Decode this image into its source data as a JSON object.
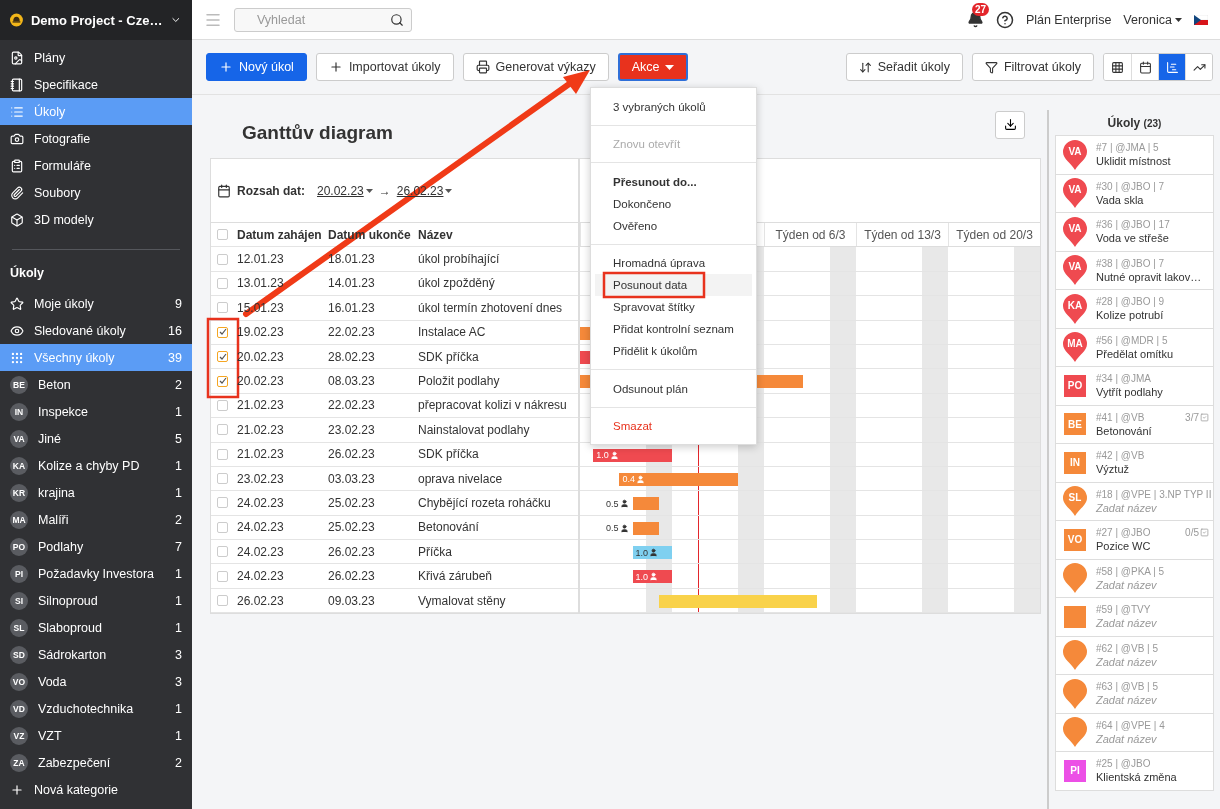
{
  "project": {
    "name": "Demo Project - Cze…"
  },
  "nav": [
    {
      "kind": "plans",
      "label": "Plány",
      "selected": false
    },
    {
      "kind": "specs",
      "label": "Specifikace",
      "selected": false
    },
    {
      "kind": "tasks",
      "label": "Úkoly",
      "selected": true
    },
    {
      "kind": "photos",
      "label": "Fotografie",
      "selected": false
    },
    {
      "kind": "forms",
      "label": "Formuláře",
      "selected": false
    },
    {
      "kind": "files",
      "label": "Soubory",
      "selected": false
    },
    {
      "kind": "models",
      "label": "3D modely",
      "selected": false
    }
  ],
  "section_title": "Úkoly",
  "filters": [
    {
      "kind": "star",
      "label": "Moje úkoly",
      "count": "9",
      "selected": false
    },
    {
      "kind": "eye",
      "label": "Sledované úkoly",
      "count": "16",
      "selected": false
    },
    {
      "kind": "grid",
      "label": "Všechny úkoly",
      "count": "39",
      "selected": true
    }
  ],
  "categories": [
    {
      "abbr": "BE",
      "label": "Beton",
      "count": "2"
    },
    {
      "abbr": "IN",
      "label": "Inspekce",
      "count": "1"
    },
    {
      "abbr": "VA",
      "label": "Jiné",
      "count": "5"
    },
    {
      "abbr": "KA",
      "label": "Kolize a chyby PD",
      "count": "1"
    },
    {
      "abbr": "KR",
      "label": "krajina",
      "count": "1"
    },
    {
      "abbr": "MA",
      "label": "Malíři",
      "count": "2"
    },
    {
      "abbr": "PO",
      "label": "Podlahy",
      "count": "7"
    },
    {
      "abbr": "PI",
      "label": "Požadavky Investora",
      "count": "1"
    },
    {
      "abbr": "SI",
      "label": "Silnoproud",
      "count": "1"
    },
    {
      "abbr": "SL",
      "label": "Slaboproud",
      "count": "1"
    },
    {
      "abbr": "SD",
      "label": "Sádrokarton",
      "count": "3"
    },
    {
      "abbr": "VO",
      "label": "Voda",
      "count": "3"
    },
    {
      "abbr": "VD",
      "label": "Vzduchotechnika",
      "count": "1"
    },
    {
      "abbr": "VZ",
      "label": "VZT",
      "count": "1"
    },
    {
      "abbr": "ZA",
      "label": "Zabezpečení",
      "count": "2"
    }
  ],
  "add_category": "Nová kategorie",
  "topbar": {
    "search_placeholder": "Vyhledat",
    "notifications": "27",
    "plan": "Plán Enterprise",
    "user": "Veronica"
  },
  "toolbar": {
    "left": [
      {
        "kind": "create",
        "label": "Nový úkol"
      },
      {
        "kind": "import",
        "label": "Importovat úkoly"
      },
      {
        "kind": "report",
        "label": "Generovat výkazy"
      },
      {
        "kind": "actions",
        "label": "Akce"
      }
    ],
    "right": [
      {
        "kind": "sort",
        "label": "Seřadit úkoly"
      },
      {
        "kind": "filter",
        "label": "Filtrovat úkoly"
      }
    ],
    "views": [
      {
        "kind": "grid",
        "selected": false
      },
      {
        "kind": "calendar",
        "selected": false
      },
      {
        "kind": "gantt",
        "selected": true
      },
      {
        "kind": "chart",
        "selected": false
      }
    ]
  },
  "menu": {
    "sections": [
      [
        {
          "kind": "normal",
          "label": "3 vybraných úkolů",
          "highlighted": false
        }
      ],
      [
        {
          "kind": "disabled",
          "label": "Znovu otevřít",
          "highlighted": false
        }
      ],
      [
        {
          "kind": "bold",
          "label": "Přesunout do...",
          "highlighted": false
        },
        {
          "kind": "normal",
          "label": "Dokončeno",
          "highlighted": false
        },
        {
          "kind": "normal",
          "label": "Ověřeno",
          "highlighted": false
        }
      ],
      [
        {
          "kind": "normal",
          "label": "Hromadná úprava",
          "highlighted": false
        },
        {
          "kind": "normal",
          "label": "Posunout data",
          "highlighted": true
        },
        {
          "kind": "normal",
          "label": "Spravovat štítky",
          "highlighted": false
        },
        {
          "kind": "normal",
          "label": "Přidat kontrolní seznam",
          "highlighted": false
        },
        {
          "kind": "normal",
          "label": "Přidělit k úkolům",
          "highlighted": false
        }
      ],
      [
        {
          "kind": "normal",
          "label": "Odsunout plán",
          "highlighted": false
        }
      ],
      [
        {
          "kind": "danger",
          "label": "Smazat",
          "highlighted": false
        }
      ]
    ]
  },
  "gantt": {
    "title": "Ganttův diagram",
    "range_label": "Rozsah dat:",
    "range_from": "20.02.23",
    "range_arrow": "→",
    "range_to": "26.02.23",
    "select_all_checked": false,
    "columns": [
      "Datum zahájen",
      "Datum ukonče",
      "Název"
    ],
    "weeks": [
      "Týden od 6/3",
      "Týden od 13/3",
      "Týden od 20/3"
    ],
    "rows": [
      {
        "checked": false,
        "start": "12.01.23",
        "end": "18.01.23",
        "name": "úkol probíhající"
      },
      {
        "checked": false,
        "start": "13.01.23",
        "end": "14.01.23",
        "name": "úkol zpožděný"
      },
      {
        "checked": false,
        "start": "15.01.23",
        "end": "16.01.23",
        "name": "úkol termín zhotovení dnes"
      },
      {
        "checked": true,
        "start": "19.02.23",
        "end": "22.02.23",
        "name": "Instalace AC",
        "bar": {
          "color": "#f5893a"
        }
      },
      {
        "checked": true,
        "start": "20.02.23",
        "end": "28.02.23",
        "name": "SDK příčka",
        "bar": {
          "color": "#ef4a50"
        }
      },
      {
        "checked": true,
        "start": "20.02.23",
        "end": "08.03.23",
        "name": "Položit podlahy",
        "bar": {
          "color": "#f5893a"
        }
      },
      {
        "checked": false,
        "start": "21.02.23",
        "end": "22.02.23",
        "name": "přepracovat kolizi v nákresu"
      },
      {
        "checked": false,
        "start": "21.02.23",
        "end": "23.02.23",
        "name": "Nainstalovat podlahy"
      },
      {
        "checked": false,
        "start": "21.02.23",
        "end": "26.02.23",
        "name": "SDK příčka",
        "bar": {
          "color": "#ef4a50",
          "label": "1.0",
          "outside": false
        }
      },
      {
        "checked": false,
        "start": "23.02.23",
        "end": "03.03.23",
        "name": "oprava nivelace",
        "bar": {
          "color": "#f5893a",
          "label": "0.4",
          "outside": false
        }
      },
      {
        "checked": false,
        "start": "24.02.23",
        "end": "25.02.23",
        "name": "Chybějící rozeta roháčku",
        "bar": {
          "color": "#f5893a",
          "label": "0.5",
          "outside": true
        }
      },
      {
        "checked": false,
        "start": "24.02.23",
        "end": "25.02.23",
        "name": "Betonování",
        "bar": {
          "color": "#f5893a",
          "label": "0.5",
          "outside": true
        }
      },
      {
        "checked": false,
        "start": "24.02.23",
        "end": "26.02.23",
        "name": "Příčka",
        "bar": {
          "color": "#7fd0f0",
          "label": "1.0",
          "outside": false
        }
      },
      {
        "checked": false,
        "start": "24.02.23",
        "end": "26.02.23",
        "name": "Křivá zárubeň",
        "bar": {
          "color": "#ef4a50",
          "label": "1.0",
          "outside": false
        }
      },
      {
        "checked": false,
        "start": "26.02.23",
        "end": "09.03.23",
        "name": "Vymalovat stěny",
        "bar": {
          "color": "#f9d24a"
        }
      }
    ]
  },
  "tasks_panel": {
    "title": "Úkoly",
    "count": "(23)",
    "tasks": [
      {
        "kind": "pin",
        "color": "#ef4a50",
        "abbr": "VA",
        "meta": "#7 | @JMA | 5",
        "name": "Uklidit místnost",
        "untitled": false
      },
      {
        "kind": "pin",
        "color": "#ef4a50",
        "abbr": "VA",
        "meta": "#30 | @JBO | 7",
        "name": "Vada skla",
        "untitled": false
      },
      {
        "kind": "pin",
        "color": "#ef4a50",
        "abbr": "VA",
        "meta": "#36 | @JBO | 17",
        "name": "Voda ve střeše",
        "untitled": false
      },
      {
        "kind": "pin",
        "color": "#ef4a50",
        "abbr": "VA",
        "meta": "#38 | @JBO | 7",
        "name": "Nutné opravit lakov…",
        "untitled": false
      },
      {
        "kind": "pin",
        "color": "#ef4a50",
        "abbr": "KA",
        "meta": "#28 | @JBO | 9",
        "name": "Kolize potrubí",
        "untitled": false
      },
      {
        "kind": "pin",
        "color": "#ef4a50",
        "abbr": "MA",
        "meta": "#56 | @MDR | 5",
        "name": "Předělat omítku",
        "untitled": false
      },
      {
        "kind": "square",
        "color": "#ef4a50",
        "abbr": "PO",
        "meta": "#34 | @JMA",
        "name": "Vytřít podlahy",
        "untitled": false
      },
      {
        "kind": "square",
        "color": "#f5893a",
        "abbr": "BE",
        "meta": "#41 | @VB",
        "name": "Betonování",
        "untitled": false,
        "progress": "3/7"
      },
      {
        "kind": "square",
        "color": "#f5893a",
        "abbr": "IN",
        "meta": "#42 | @VB",
        "name": "Výztuž",
        "untitled": false
      },
      {
        "kind": "pin",
        "color": "#f5893a",
        "abbr": "SL",
        "meta": "#18 | @VPE | 3.NP TYP II",
        "name": "Zadat název",
        "untitled": true
      },
      {
        "kind": "square",
        "color": "#f5893a",
        "abbr": "VO",
        "meta": "#27 | @JBO",
        "name": "Pozice WC",
        "untitled": false,
        "progress": "0/5"
      },
      {
        "kind": "pin",
        "color": "#f5893a",
        "meta": "#58 | @PKA | 5",
        "name": "Zadat název",
        "untitled": true
      },
      {
        "kind": "square",
        "color": "#f5893a",
        "meta": "#59 | @TVY",
        "name": "Zadat název",
        "untitled": true
      },
      {
        "kind": "pin",
        "color": "#f5893a",
        "meta": "#62 | @VB | 5",
        "name": "Zadat název",
        "untitled": true
      },
      {
        "kind": "pin",
        "color": "#f5893a",
        "meta": "#63 | @VB | 5",
        "name": "Zadat název",
        "untitled": true
      },
      {
        "kind": "pin",
        "color": "#f5893a",
        "meta": "#64 | @VPE | 4",
        "name": "Zadat název",
        "untitled": true
      },
      {
        "kind": "square",
        "color": "#ec4fe6",
        "abbr": "PI",
        "meta": "#25 | @JBO",
        "name": "Klientská změna",
        "untitled": false
      }
    ]
  }
}
